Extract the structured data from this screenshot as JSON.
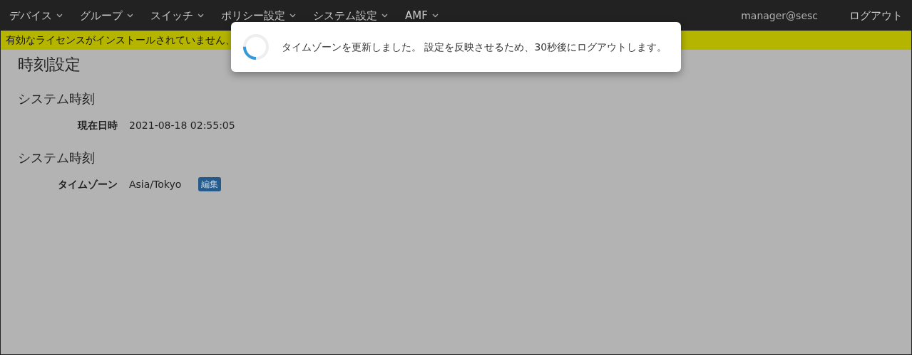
{
  "navbar": {
    "menus": [
      {
        "label": "デバイス"
      },
      {
        "label": "グループ"
      },
      {
        "label": "スイッチ"
      },
      {
        "label": "ポリシー設定"
      },
      {
        "label": "システム設定"
      },
      {
        "label": "AMF"
      }
    ],
    "user": "manager@sesc",
    "logout": "ログアウト"
  },
  "license_banner": "有効なライセンスがインストールされていません、",
  "page_title": "時刻設定",
  "sections": [
    {
      "heading": "システム時刻",
      "fields": [
        {
          "label": "現在日時",
          "value": "2021-08-18 02:55:05"
        }
      ]
    },
    {
      "heading": "システム時刻",
      "fields": [
        {
          "label": "タイムゾーン",
          "value": "Asia/Tokyo",
          "button": "編集"
        }
      ]
    }
  ],
  "dialog": {
    "message": "タイムゾーンを更新しました。 設定を反映させるため、30秒後にログアウトします。"
  }
}
